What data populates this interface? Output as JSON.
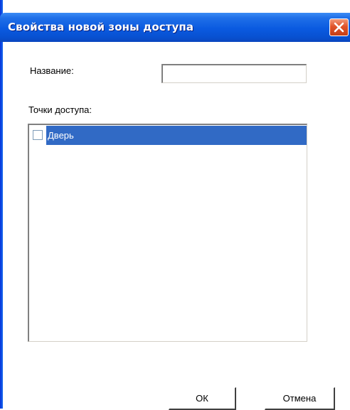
{
  "window": {
    "title": "Свойства новой зоны доступа"
  },
  "form": {
    "name_label": "Название:",
    "name_value": "",
    "points_label": "Точки доступа:"
  },
  "access_points": [
    {
      "label": "Дверь",
      "checked": false,
      "selected": true
    }
  ],
  "buttons": {
    "ok_label": "ОК",
    "cancel_label": "Отмена"
  },
  "colors": {
    "titlebar": "#0a5ae0",
    "selection": "#316ac5",
    "close_button": "#e0532a"
  },
  "icons": {
    "close": "close-icon"
  }
}
